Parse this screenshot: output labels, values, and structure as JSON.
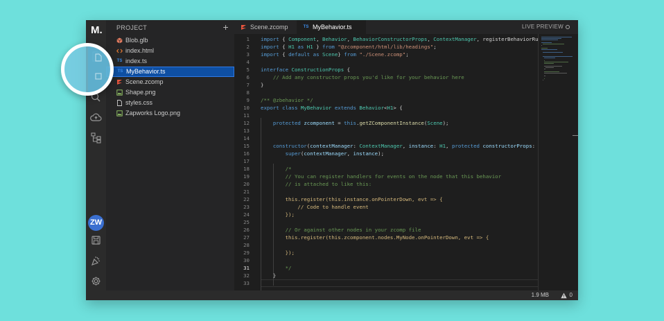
{
  "app": {
    "logo": "M."
  },
  "sidebar": {
    "header": "PROJECT",
    "add_label": "+",
    "files": [
      {
        "name": "Blob.glb",
        "icon": "cube-icon",
        "color": "#e07a5f"
      },
      {
        "name": "index.html",
        "icon": "html-icon",
        "color": "#e37933"
      },
      {
        "name": "index.ts",
        "icon": "ts-icon",
        "color": "#3c8ce7"
      },
      {
        "name": "MyBehavior.ts",
        "icon": "ts-icon",
        "color": "#3c8ce7",
        "active": true
      },
      {
        "name": "Scene.zcomp",
        "icon": "zcomp-icon",
        "color": "#e8553e"
      },
      {
        "name": "Shape.png",
        "icon": "image-icon",
        "color": "#9acd6a"
      },
      {
        "name": "styles.css",
        "icon": "css-file-icon",
        "color": "#cccccc"
      },
      {
        "name": "Zapworks Logo.png",
        "icon": "image-icon",
        "color": "#9acd6a"
      }
    ]
  },
  "activity": {
    "avatar": "ZW",
    "icons": [
      "files-icon",
      "search-icon",
      "cloud-upload-icon",
      "hierarchy-icon",
      "save-icon",
      "celebration-icon",
      "gear-icon"
    ]
  },
  "tabs": [
    {
      "label": "Scene.zcomp",
      "icon": "zcomp-icon",
      "active": false
    },
    {
      "label": "MyBehavior.ts",
      "icon": "ts-icon",
      "active": true
    }
  ],
  "icon_labels": {
    "ts": "TS"
  },
  "live_preview": "LIVE PREVIEW",
  "editor": {
    "current_line": 31,
    "lines": [
      [
        [
          "k",
          "import"
        ],
        [
          "p",
          " { "
        ],
        [
          "t",
          "Component"
        ],
        [
          "p",
          ", "
        ],
        [
          "t",
          "Behavior"
        ],
        [
          "p",
          ", "
        ],
        [
          "t",
          "BehaviorConstructorProps"
        ],
        [
          "p",
          ", "
        ],
        [
          "t",
          "ContextManager"
        ],
        [
          "p",
          ", registerBehaviorRu"
        ]
      ],
      [
        [
          "k",
          "import"
        ],
        [
          "p",
          " { "
        ],
        [
          "t",
          "H1"
        ],
        [
          "p",
          " "
        ],
        [
          "k",
          "as"
        ],
        [
          "p",
          " "
        ],
        [
          "t",
          "H1"
        ],
        [
          "p",
          " } "
        ],
        [
          "k",
          "from"
        ],
        [
          "p",
          " "
        ],
        [
          "s",
          "\"@zcomponent/html/lib/headings\""
        ],
        [
          "p",
          ";"
        ]
      ],
      [
        [
          "k",
          "import"
        ],
        [
          "p",
          " { "
        ],
        [
          "k",
          "default"
        ],
        [
          "p",
          " "
        ],
        [
          "k",
          "as"
        ],
        [
          "p",
          " "
        ],
        [
          "t",
          "Scene"
        ],
        [
          "p",
          "} "
        ],
        [
          "k",
          "from"
        ],
        [
          "p",
          " "
        ],
        [
          "s",
          "\"./Scene.zcomp\""
        ],
        [
          "p",
          ";"
        ]
      ],
      [],
      [
        [
          "k",
          "interface"
        ],
        [
          "p",
          " "
        ],
        [
          "t",
          "ConstructionProps"
        ],
        [
          "p",
          " {"
        ]
      ],
      [
        [
          "p",
          "    "
        ],
        [
          "c",
          "// Add any constructor props you'd like for your behavior here"
        ]
      ],
      [
        [
          "p",
          "}"
        ]
      ],
      [],
      [
        [
          "c",
          "/** @zbehavior */"
        ]
      ],
      [
        [
          "k",
          "export"
        ],
        [
          "p",
          " "
        ],
        [
          "k",
          "class"
        ],
        [
          "p",
          " "
        ],
        [
          "t",
          "MyBehavior"
        ],
        [
          "p",
          " "
        ],
        [
          "k",
          "extends"
        ],
        [
          "p",
          " "
        ],
        [
          "t",
          "Behavior"
        ],
        [
          "p",
          "<"
        ],
        [
          "t",
          "H1"
        ],
        [
          "p",
          "> {"
        ]
      ],
      [],
      [
        [
          "p",
          "    "
        ],
        [
          "k",
          "protected"
        ],
        [
          "p",
          " "
        ],
        [
          "v",
          "zcomponent"
        ],
        [
          "p",
          " = "
        ],
        [
          "k",
          "this"
        ],
        [
          "p",
          "."
        ],
        [
          "f",
          "getZComponentInstance"
        ],
        [
          "p",
          "("
        ],
        [
          "t",
          "Scene"
        ],
        [
          "p",
          ");"
        ]
      ],
      [],
      [],
      [
        [
          "p",
          "    "
        ],
        [
          "k",
          "constructor"
        ],
        [
          "p",
          "("
        ],
        [
          "v",
          "contextManager"
        ],
        [
          "p",
          ": "
        ],
        [
          "t",
          "ContextManager"
        ],
        [
          "p",
          ", "
        ],
        [
          "v",
          "instance"
        ],
        [
          "p",
          ": "
        ],
        [
          "t",
          "H1"
        ],
        [
          "p",
          ", "
        ],
        [
          "k",
          "protected"
        ],
        [
          "p",
          " "
        ],
        [
          "v",
          "constructorProps"
        ],
        [
          "p",
          ":"
        ]
      ],
      [
        [
          "p",
          "        "
        ],
        [
          "k",
          "super"
        ],
        [
          "p",
          "("
        ],
        [
          "v",
          "contextManager"
        ],
        [
          "p",
          ", "
        ],
        [
          "v",
          "instance"
        ],
        [
          "p",
          ");"
        ]
      ],
      [],
      [
        [
          "p",
          "        "
        ],
        [
          "c",
          "/*"
        ]
      ],
      [
        [
          "p",
          "        "
        ],
        [
          "c",
          "// You can register handlers for events on the node that this behavior"
        ]
      ],
      [
        [
          "p",
          "        "
        ],
        [
          "c",
          "// is attached to like this:"
        ]
      ],
      [],
      [
        [
          "p",
          "        "
        ],
        [
          "y",
          "this.register(this.instance.onPointerDown, evt => {"
        ]
      ],
      [
        [
          "p",
          "            "
        ],
        [
          "y",
          "// Code to handle event"
        ]
      ],
      [
        [
          "p",
          "        "
        ],
        [
          "y",
          "});"
        ]
      ],
      [],
      [
        [
          "p",
          "        "
        ],
        [
          "c",
          "// Or against other nodes in your zcomp file"
        ]
      ],
      [
        [
          "p",
          "        "
        ],
        [
          "y",
          "this.register(this.zcomponent.nodes.MyNode.onPointerDown, evt => {"
        ]
      ],
      [],
      [
        [
          "p",
          "        "
        ],
        [
          "y",
          "});"
        ]
      ],
      [],
      [
        [
          "p",
          "        "
        ],
        [
          "c",
          "*/"
        ]
      ],
      [
        [
          "p",
          "    }"
        ]
      ],
      []
    ]
  },
  "status": {
    "size": "1.9 MB",
    "warnings": "0"
  },
  "colors": {
    "accent": "#0e4fa3",
    "background": "#6ee0dc"
  }
}
